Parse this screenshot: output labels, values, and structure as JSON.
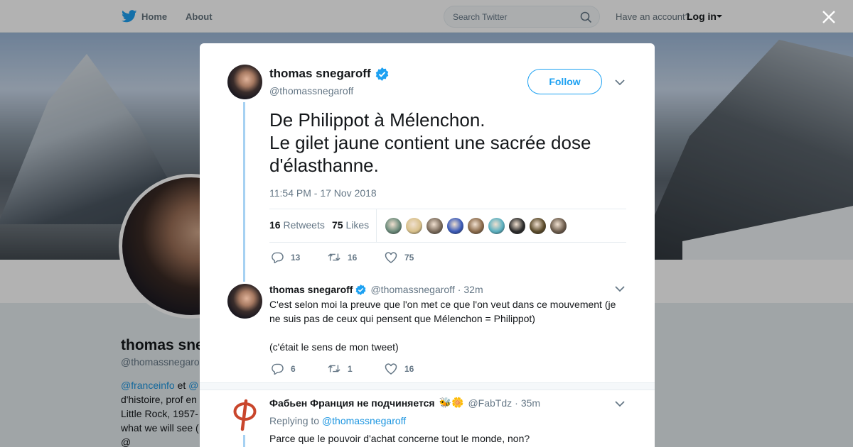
{
  "topbar": {
    "home_label": "Home",
    "about_label": "About",
    "search_placeholder": "Search Twitter",
    "account_prompt": "Have an account?",
    "login_label": "Log in"
  },
  "profile": {
    "name": "thomas sne",
    "handle": "@thomassnegarof",
    "bio_line1_link1": "@franceinfo",
    "bio_line1_mid": " et ",
    "bio_line1_link2": "@",
    "bio_line2": "d'histoire, prof en",
    "bio_line3": "Little Rock, 1957-",
    "bio_line4": "what we will see (",
    "bio_line5": "@ "
  },
  "tweet": {
    "author_name": "thomas snegaroff",
    "author_handle": "@thomassnegaroff",
    "follow_label": "Follow",
    "text": "De Philippot à Mélenchon.\nLe gilet jaune contient une sacrée dose d'élasthanne.",
    "timestamp": "11:54 PM - 17 Nov 2018",
    "retweets_count": "16",
    "retweets_label": "Retweets",
    "likes_count": "75",
    "likes_label": "Likes",
    "liker_colors": [
      "#6a8a7a",
      "#d8c08a",
      "#7a6a5a",
      "#3a5ab8",
      "#8a6a4a",
      "#5ab0c0",
      "#2a2a2a",
      "#5a4a2a",
      "#6a5a4a"
    ],
    "actions": {
      "replies": "13",
      "retweets": "16",
      "likes": "75"
    }
  },
  "replies": [
    {
      "author_name": "thomas snegaroff",
      "author_handle": "@thomassnegaroff",
      "time": "32m",
      "text": "C'est selon moi la preuve que l'on met ce que l'on veut dans ce mouvement (je ne suis pas de ceux qui pensent que Mélenchon = Philippot)\n\n(c'était le sens de mon tweet)",
      "actions": {
        "replies": "6",
        "retweets": "1",
        "likes": "16"
      }
    },
    {
      "author_name": "Фабьен Франция не подчиняется",
      "author_emoji": "🐝🌼",
      "author_handle": "@FabTdz",
      "time": "35m",
      "replying_to_label": "Replying to",
      "replying_to_handle": "@thomassnegaroff",
      "text": "Parce que le pouvoir d'achat concerne tout le monde, non?"
    }
  ],
  "colors": {
    "accent": "#1da1f2",
    "link": "#1b95e0",
    "muted": "#657786",
    "thread_line": "#a6d1f2",
    "fi_red": "#c9462c"
  }
}
